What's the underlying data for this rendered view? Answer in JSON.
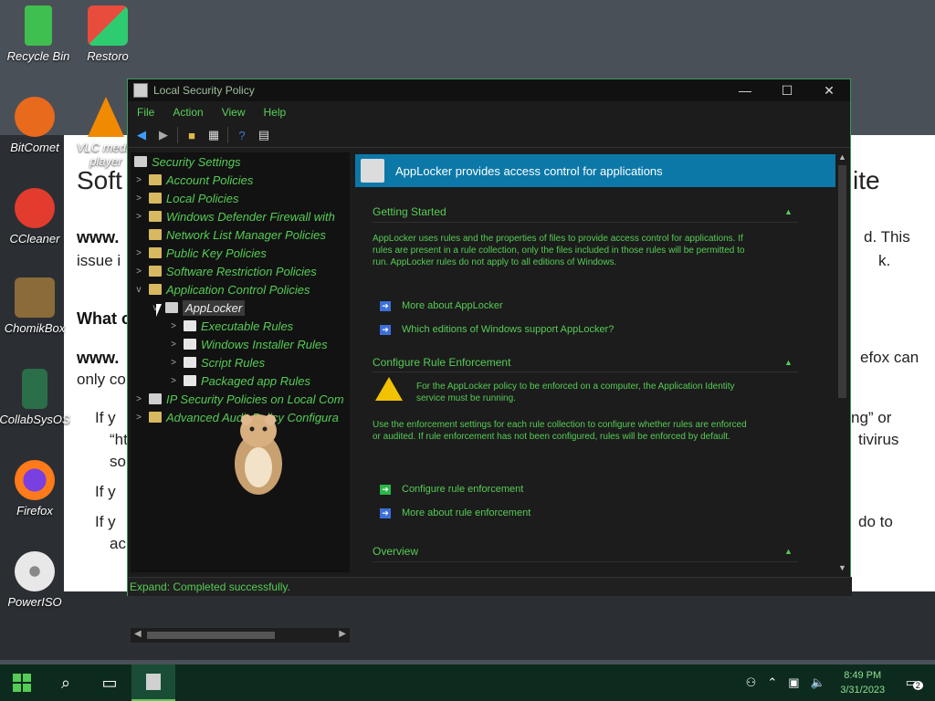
{
  "desktop": {
    "icons": [
      {
        "label": "Recycle Bin"
      },
      {
        "label": "Restoro"
      },
      {
        "label": "BitComet"
      },
      {
        "label": "VLC media player"
      },
      {
        "label": "CCleaner"
      },
      {
        "label": "ChomikBox"
      },
      {
        "label": "CollabSysOS"
      },
      {
        "label": "Firefox"
      },
      {
        "label": "PowerISO"
      }
    ]
  },
  "background_page": {
    "fragments": [
      "Soft",
      "ite",
      "www.",
      "d. This",
      "issue i",
      "k.",
      "What c",
      "www.",
      "efox can",
      "only co",
      "If y",
      "ng” or",
      "“ht",
      "tivirus",
      "so",
      "If y",
      "If y",
      "do to",
      "ac"
    ]
  },
  "window": {
    "title": "Local Security Policy",
    "controls": {
      "minimize": "—",
      "maximize": "☐",
      "close": "✕"
    },
    "menu": [
      "File",
      "Action",
      "View",
      "Help"
    ],
    "tree": [
      {
        "label": "Security Settings",
        "level": 0
      },
      {
        "label": "Account Policies",
        "level": 1
      },
      {
        "label": "Local Policies",
        "level": 1
      },
      {
        "label": "Windows Defender Firewall with",
        "level": 1
      },
      {
        "label": "Network List Manager Policies",
        "level": 1
      },
      {
        "label": "Public Key Policies",
        "level": 1
      },
      {
        "label": "Software Restriction Policies",
        "level": 1
      },
      {
        "label": "Application Control Policies",
        "level": 1
      },
      {
        "label": "AppLocker",
        "level": 2
      },
      {
        "label": "Executable Rules",
        "level": 3
      },
      {
        "label": "Windows Installer Rules",
        "level": 3
      },
      {
        "label": "Script Rules",
        "level": 3
      },
      {
        "label": "Packaged app Rules",
        "level": 3
      },
      {
        "label": "IP Security Policies on Local Com",
        "level": 1
      },
      {
        "label": "Advanced Audit Policy Configura",
        "level": 1
      }
    ],
    "right": {
      "header": "AppLocker provides access control for applications",
      "getting_started": {
        "title": "Getting Started",
        "text": "AppLocker uses rules and the properties of files to provide access control for applications. If rules are present in a rule collection, only the files included in those rules will be permitted to run. AppLocker rules do not apply to all editions of Windows.",
        "links": [
          "More about AppLocker",
          "Which editions of Windows support AppLocker?"
        ]
      },
      "configure": {
        "title": "Configure Rule Enforcement",
        "warning": "For the AppLocker policy to be enforced on a computer, the Application Identity service must be running.",
        "text": "Use the enforcement settings for each rule collection to configure whether rules are enforced or audited. If rule enforcement has not been configured, rules will be enforced by default.",
        "links": [
          "Configure rule enforcement",
          "More about rule enforcement"
        ]
      },
      "overview": {
        "title": "Overview"
      }
    },
    "status": "Expand:  Completed successfully."
  },
  "taskbar": {
    "time": "8:49 PM",
    "date": "3/31/2023",
    "notifications": "2"
  },
  "colors": {
    "accent": "#55cc55",
    "header": "#0b78a8"
  }
}
